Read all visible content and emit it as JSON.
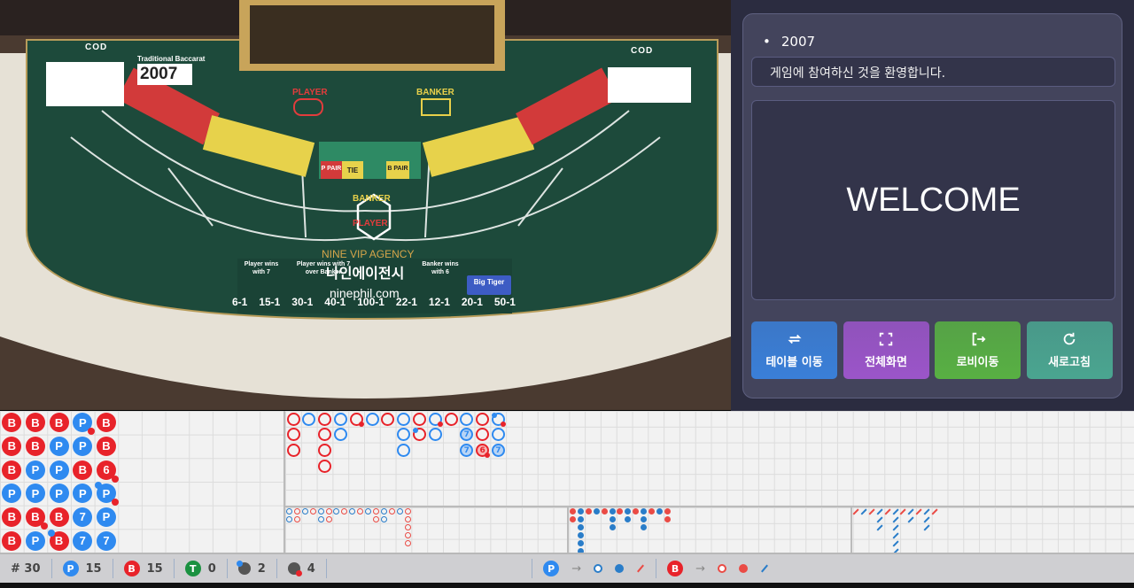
{
  "video": {
    "table_name": "Traditional Baccarat",
    "table_number": "2007",
    "brand": "COD",
    "player_label": "PLAYER",
    "banker_label": "BANKER",
    "pair_p": "P PAIR",
    "tie": "TIE",
    "pair_b": "B PAIR",
    "watermark_en": "NINE VIP AGENCY",
    "watermark_ko": "나인에이전시",
    "watermark_url": "ninephil.com",
    "payouts": [
      "6-1",
      "15-1",
      "30-1",
      "40-1",
      "100-1",
      "22-1",
      "12-1",
      "20-1",
      "50-1"
    ],
    "side_bets": [
      "Player wins with 7",
      "Player wins with 7 over Banker",
      "Banker wins with 6",
      "Big Tiger"
    ]
  },
  "panel": {
    "table_id": "2007",
    "welcome_message": "게임에 참여하신 것을 환영합니다.",
    "welcome_title": "WELCOME",
    "buttons": [
      {
        "label": "테이블 이동",
        "icon": "swap-icon",
        "color": "#3a7fd8"
      },
      {
        "label": "전체화면",
        "icon": "fullscreen-icon",
        "color": "#9b55c9"
      },
      {
        "label": "로비이동",
        "icon": "exit-icon",
        "color": "#58b043"
      },
      {
        "label": "새로고침",
        "icon": "refresh-icon",
        "color": "#4aa590"
      }
    ]
  },
  "colors": {
    "banker": "#e8232a",
    "player": "#2f8af0",
    "tie": "#1a9140",
    "big_eye_red": "#ea4b45",
    "big_eye_blue": "#2a7dc9"
  },
  "bead_road": [
    [
      "B",
      "B",
      "B",
      "P",
      "B",
      "B"
    ],
    [
      "B",
      "B",
      "P",
      "P",
      "B*r",
      "P"
    ],
    [
      "B",
      "P",
      "P",
      "P",
      "B",
      "B*p"
    ],
    [
      "P*r",
      "P",
      "B",
      "P",
      "7",
      "7"
    ],
    [
      "B",
      "B",
      "6*r",
      "P*pr",
      "P",
      "7"
    ]
  ],
  "big_road": [
    [
      "B",
      "B",
      "B"
    ],
    [
      "P"
    ],
    [
      "B",
      "B",
      "B",
      "B"
    ],
    [
      "P",
      "P"
    ],
    [
      "B*r"
    ],
    [
      "P"
    ],
    [
      "B"
    ],
    [
      "P",
      "P",
      "P"
    ],
    [
      "B",
      "B*p"
    ],
    [
      "P*r",
      "P"
    ],
    [
      "B"
    ],
    [
      "P",
      "P7",
      "P7"
    ],
    [
      "B",
      "B",
      "B6*r"
    ],
    [
      "P*pr",
      "P",
      "P7"
    ]
  ],
  "big_eye_road": [
    [
      "b",
      "b"
    ],
    [
      "r",
      "r"
    ],
    [
      "b"
    ],
    [
      "r"
    ],
    [
      "b",
      "b"
    ],
    [
      "r",
      "r"
    ],
    [
      "b"
    ],
    [
      "r"
    ],
    [
      "b"
    ],
    [
      "r"
    ],
    [
      "b"
    ],
    [
      "r",
      "r"
    ],
    [
      "b",
      "b"
    ],
    [
      "r"
    ],
    [
      "b"
    ],
    [
      "r",
      "r",
      "r",
      "r",
      "r"
    ]
  ],
  "small_road": [
    [
      "r",
      "r"
    ],
    [
      "b",
      "b",
      "b",
      "b",
      "b",
      "b"
    ],
    [
      "r"
    ],
    [
      "b"
    ],
    [
      "r"
    ],
    [
      "b",
      "b",
      "b"
    ],
    [
      "r"
    ],
    [
      "b",
      "b"
    ],
    [
      "r"
    ],
    [
      "b",
      "b",
      "b"
    ],
    [
      "r"
    ],
    [
      "b"
    ],
    [
      "r",
      "r"
    ]
  ],
  "cockroach_road": [
    [
      "r"
    ],
    [
      "b"
    ],
    [
      "r"
    ],
    [
      "b",
      "b",
      "b"
    ],
    [
      "r"
    ],
    [
      "b",
      "b",
      "b",
      "b",
      "b",
      "b"
    ],
    [
      "r"
    ],
    [
      "b",
      "b"
    ],
    [
      "r"
    ],
    [
      "b",
      "b",
      "b"
    ],
    [
      "r"
    ]
  ],
  "stats": {
    "rounds": "# 30",
    "player": "15",
    "banker": "15",
    "tie": "0",
    "player_pair": "2",
    "banker_pair": "4",
    "player_letter": "P",
    "banker_letter": "B",
    "tie_letter": "T",
    "arrow": "→"
  }
}
